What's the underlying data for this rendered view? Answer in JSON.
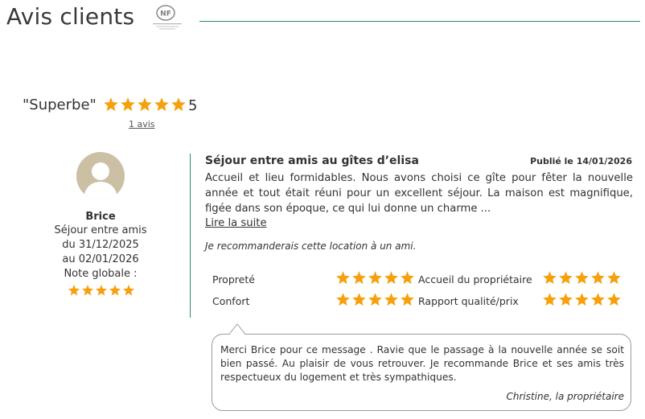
{
  "header": {
    "title": "Avis clients",
    "logo_text": "NF"
  },
  "summary": {
    "quote": "\"Superbe\"",
    "rating": 5,
    "score": "5",
    "review_count": "1 avis"
  },
  "review": {
    "reviewer": {
      "name": "Brice",
      "group": "Séjour entre amis",
      "from": "du 31/12/2025",
      "to": "au 02/01/2026",
      "note_label": "Note globale :",
      "overall_rating": 5
    },
    "title": "Séjour entre amis au gîtes d’elisa",
    "published": "Publié le 14/01/2026",
    "body": "Accueil et lieu formidables. Nous avons choisi ce gîte pour fêter la nouvelle année et tout était réuni pour un excellent séjour. La maison est magnifique, figée dans son époque, ce qui lui donne un charme ...",
    "read_more": "Lire la suite",
    "recommendation": "Je recommanderais cette location à un ami.",
    "ratings": [
      {
        "label": "Propreté",
        "value": 5
      },
      {
        "label": "Confort",
        "value": 5
      },
      {
        "label": "Accueil du propriétaire",
        "value": 5
      },
      {
        "label": "Rapport qualité/prix",
        "value": 5
      }
    ],
    "reply": {
      "text": "Merci Brice pour ce message . Ravie que le passage à la nouvelle année se soit bien passé. Au plaisir de vous retrouver. Je recommande Brice et ses amis très respectueux du logement et très sympathiques.",
      "signature": "Christine, la propriétaire"
    }
  },
  "colors": {
    "star": "#f5a10e",
    "accent_line": "#2e8a60",
    "avatar_bg": "#cbbfa4",
    "text": "#333333"
  },
  "icons": {
    "star": "star-icon",
    "avatar": "user-avatar-icon",
    "logo": "nf-logo-icon"
  }
}
